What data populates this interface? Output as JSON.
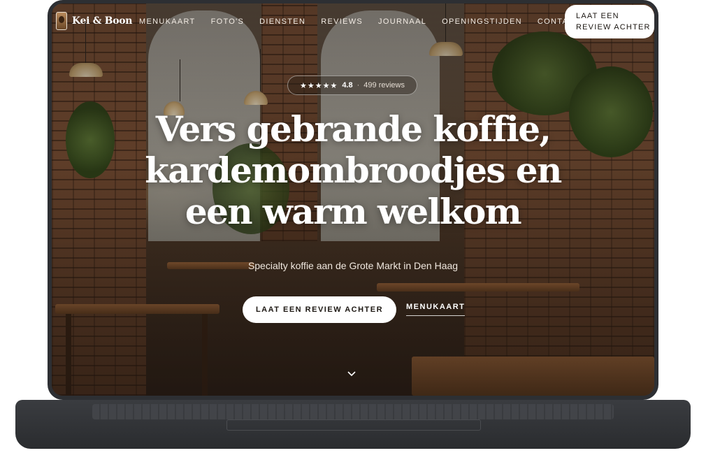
{
  "brand": {
    "name": "Kei & Boon"
  },
  "nav": {
    "items": [
      "Menukaart",
      "Foto's",
      "Diensten",
      "Reviews",
      "Journaal",
      "Openingstijden",
      "Contact"
    ],
    "cta_line1": "Laat een",
    "cta_line2": "review achter"
  },
  "rating": {
    "stars": "★★★★★",
    "score": "4.8",
    "separator": "·",
    "count": "499 reviews"
  },
  "hero": {
    "title_line1": "Vers gebrande koffie,",
    "title_line2": "kardemombroodjes en",
    "title_line3": "een warm welkom",
    "subtitle": "Specialty koffie aan de Grote Markt in Den Haag",
    "primary_button": "Laat een review achter",
    "secondary_link": "Menukaart"
  },
  "icons": {
    "scroll": "chevron-down-icon",
    "logo": "coffee-cup-logo-icon"
  },
  "colors": {
    "accent_button": "#ffffff",
    "text_dark": "#1c1712",
    "frame": "#2d2f33"
  }
}
